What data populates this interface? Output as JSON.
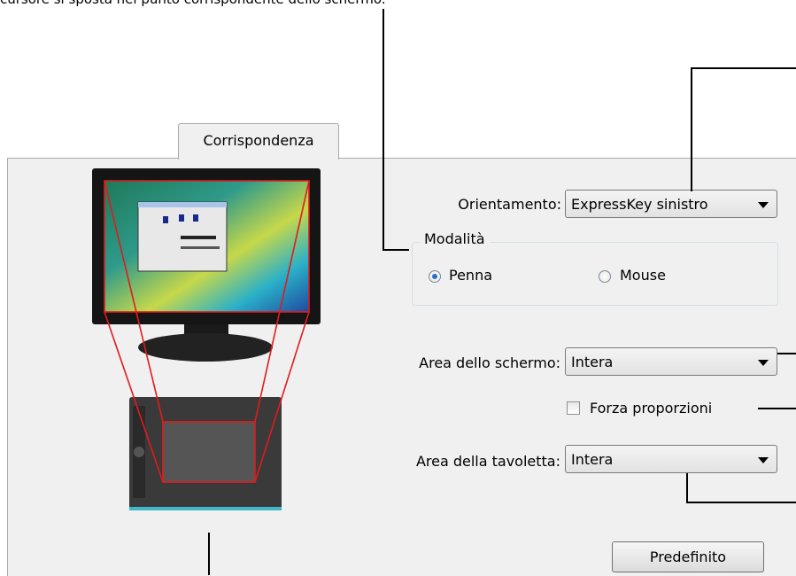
{
  "intro_text": "cursore si sposta nel punto corrispondente dello schermo.",
  "tab": {
    "label": "Corrispondenza"
  },
  "orientation": {
    "label": "Orientamento:",
    "value": "ExpressKey sinistro"
  },
  "mode": {
    "legend": "Modalità",
    "pen_label": "Penna",
    "mouse_label": "Mouse",
    "selected": "Penna"
  },
  "screen_area": {
    "label": "Area dello schermo:",
    "value": "Intera"
  },
  "force_proportions": {
    "label": "Forza proporzioni",
    "checked": false
  },
  "tablet_area": {
    "label": "Area della tavoletta:",
    "value": "Intera"
  },
  "default_button": {
    "label": "Predefinito"
  },
  "colors": {
    "mapping_outline": "#e11b1b",
    "panel_bg": "#f0f0f0",
    "radio_dot": "#2a6fc9"
  }
}
